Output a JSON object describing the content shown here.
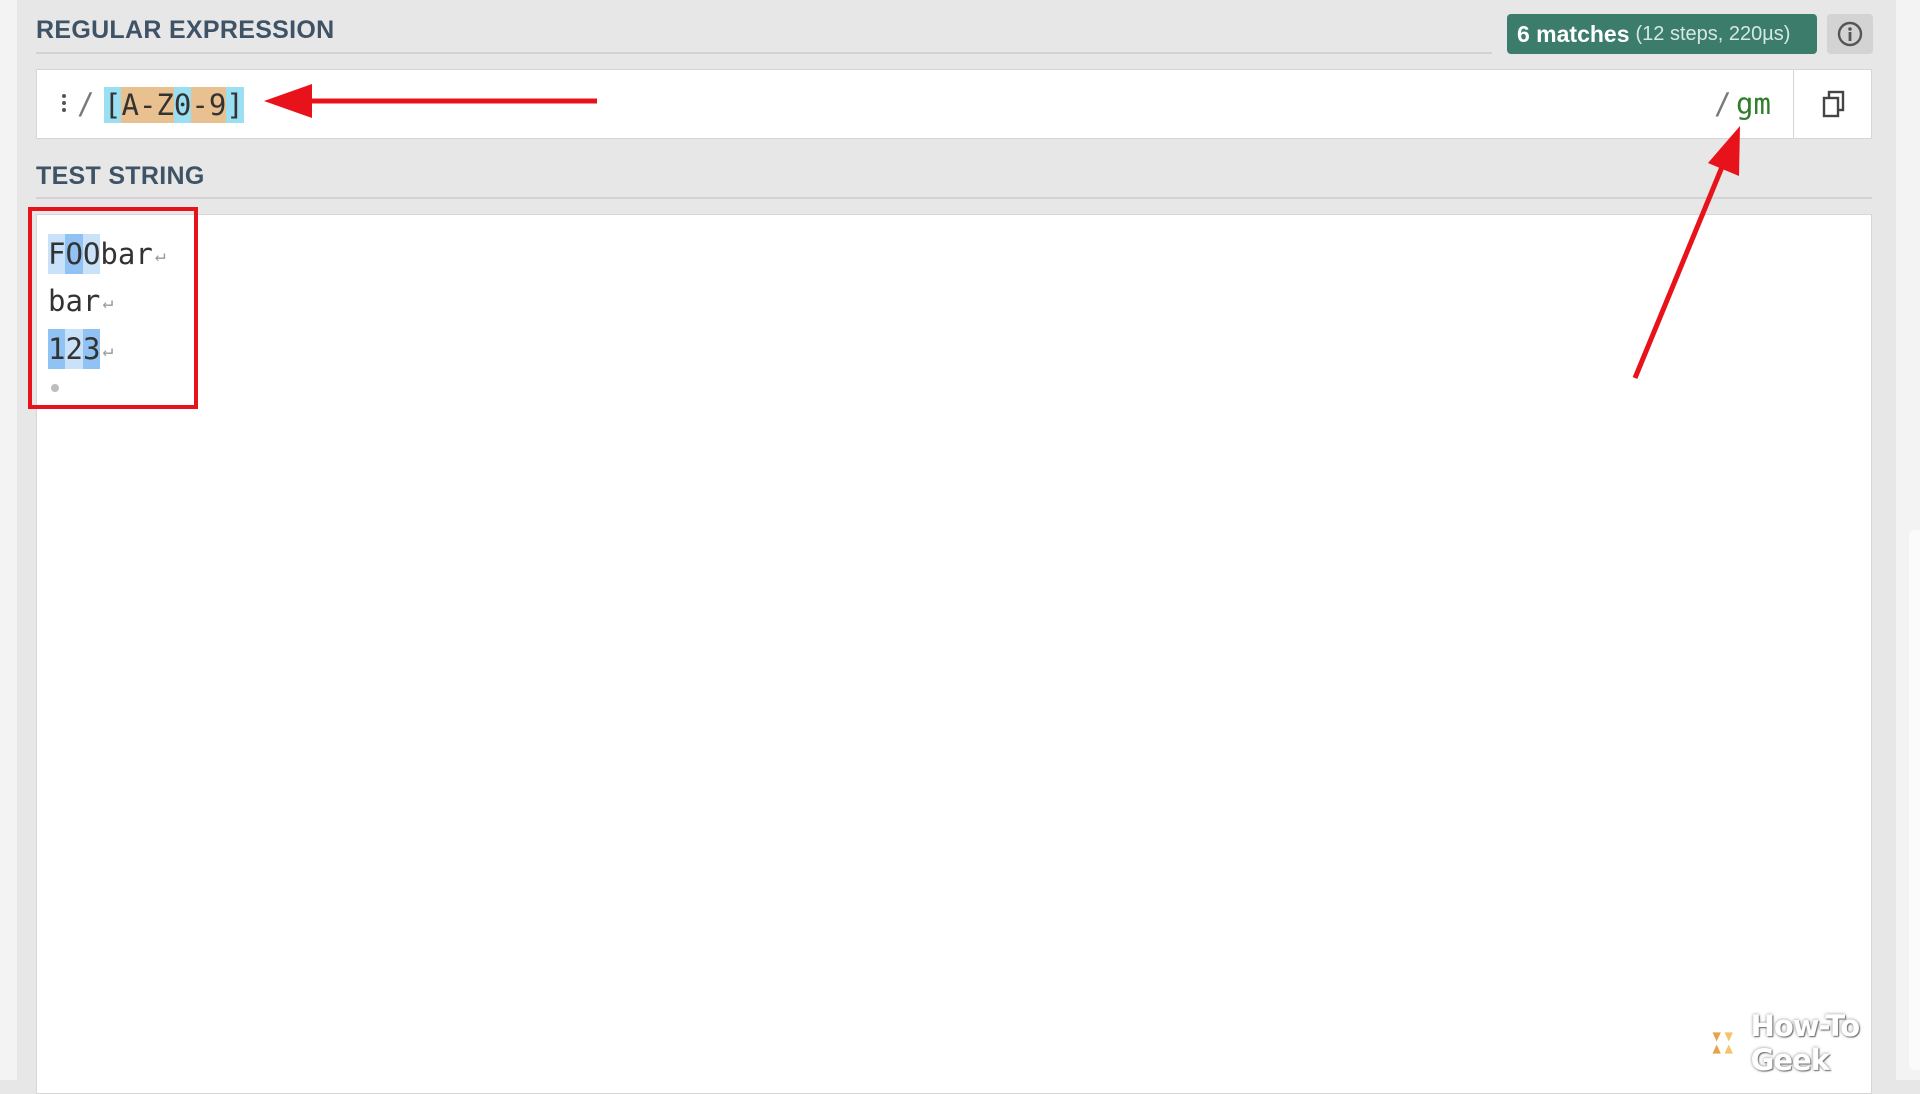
{
  "regex_section": {
    "label": "REGULAR EXPRESSION",
    "match_count": "6 matches",
    "match_detail": "(12 steps, 220µs)",
    "open_delimiter": "/",
    "pattern_tokens": [
      {
        "text": "[",
        "kind": "set"
      },
      {
        "text": "A",
        "kind": "range"
      },
      {
        "text": "-",
        "kind": "range"
      },
      {
        "text": "Z",
        "kind": "range"
      },
      {
        "text": "0",
        "kind": "set"
      },
      {
        "text": "-",
        "kind": "range"
      },
      {
        "text": "9",
        "kind": "range"
      },
      {
        "text": "]",
        "kind": "set"
      }
    ],
    "close_delimiter": "/",
    "flags": "gm"
  },
  "test_section": {
    "label": "TEST STRING",
    "lines": [
      {
        "segments": [
          {
            "text": "F",
            "hl": "a"
          },
          {
            "text": "O",
            "hl": "b"
          },
          {
            "text": "O",
            "hl": "a"
          },
          {
            "text": "bar",
            "hl": ""
          }
        ],
        "newline": "↵"
      },
      {
        "segments": [
          {
            "text": "bar",
            "hl": ""
          }
        ],
        "newline": "↵"
      },
      {
        "segments": [
          {
            "text": "1",
            "hl": "b"
          },
          {
            "text": "2",
            "hl": "a"
          },
          {
            "text": "3",
            "hl": "b"
          }
        ],
        "newline": "↵"
      }
    ]
  },
  "icons": {
    "info": "info-circle-icon",
    "copy": "copy-icon",
    "drag": "drag-handle-icon",
    "watermark_logo": "how-to-geek-logo-icon"
  },
  "watermark": {
    "text": "How-To Geek"
  },
  "colors": {
    "badge": "#3c7c6b",
    "flags": "#2d7d2b",
    "annotation": "#e8121b",
    "match_light": "#c9e2fa",
    "match_dark": "#90c3f3",
    "token_set": "#9bdff2",
    "token_range": "#e9c08f"
  }
}
